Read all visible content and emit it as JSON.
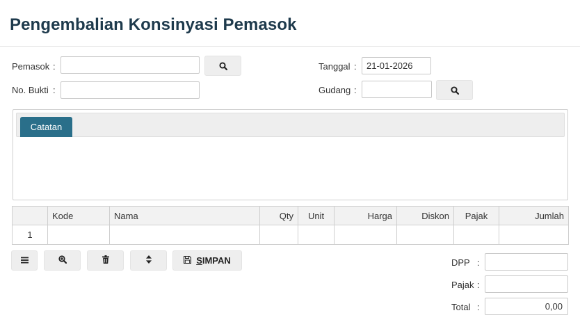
{
  "page": {
    "title": "Pengembalian Konsinyasi Pemasok"
  },
  "colon": ":",
  "form": {
    "pemasok": {
      "label": "Pemasok",
      "value": ""
    },
    "no_bukti": {
      "label": "No. Bukti",
      "value": ""
    },
    "tanggal": {
      "label": "Tanggal",
      "value": "21-01-2026"
    },
    "gudang": {
      "label": "Gudang",
      "value": ""
    }
  },
  "tabs": [
    {
      "label": "Catatan"
    }
  ],
  "table": {
    "headers": [
      "",
      "Kode",
      "Nama",
      "Qty",
      "Unit",
      "Harga",
      "Diskon",
      "Pajak",
      "Jumlah"
    ],
    "rows": [
      [
        "1",
        "",
        "",
        "",
        "",
        "",
        "",
        "",
        ""
      ]
    ]
  },
  "toolbar": {
    "save_accesskey": "S",
    "save_rest": "IMPAN"
  },
  "summary": {
    "dpp": {
      "label": "DPP",
      "value": ""
    },
    "pajak": {
      "label": "Pajak",
      "value": ""
    },
    "total": {
      "label": "Total",
      "value": "0,00"
    }
  },
  "icons": {
    "search": "search-icon",
    "menu": "menu-icon",
    "zoom": "zoom-in-icon",
    "delete": "trash-icon",
    "sort": "sort-icon",
    "save": "floppy-disk-icon"
  },
  "colors": {
    "title": "#1e3a4c",
    "tab_active": "#2a6f8a",
    "button_bg": "#eeeeee",
    "border": "#cfcfcf"
  }
}
